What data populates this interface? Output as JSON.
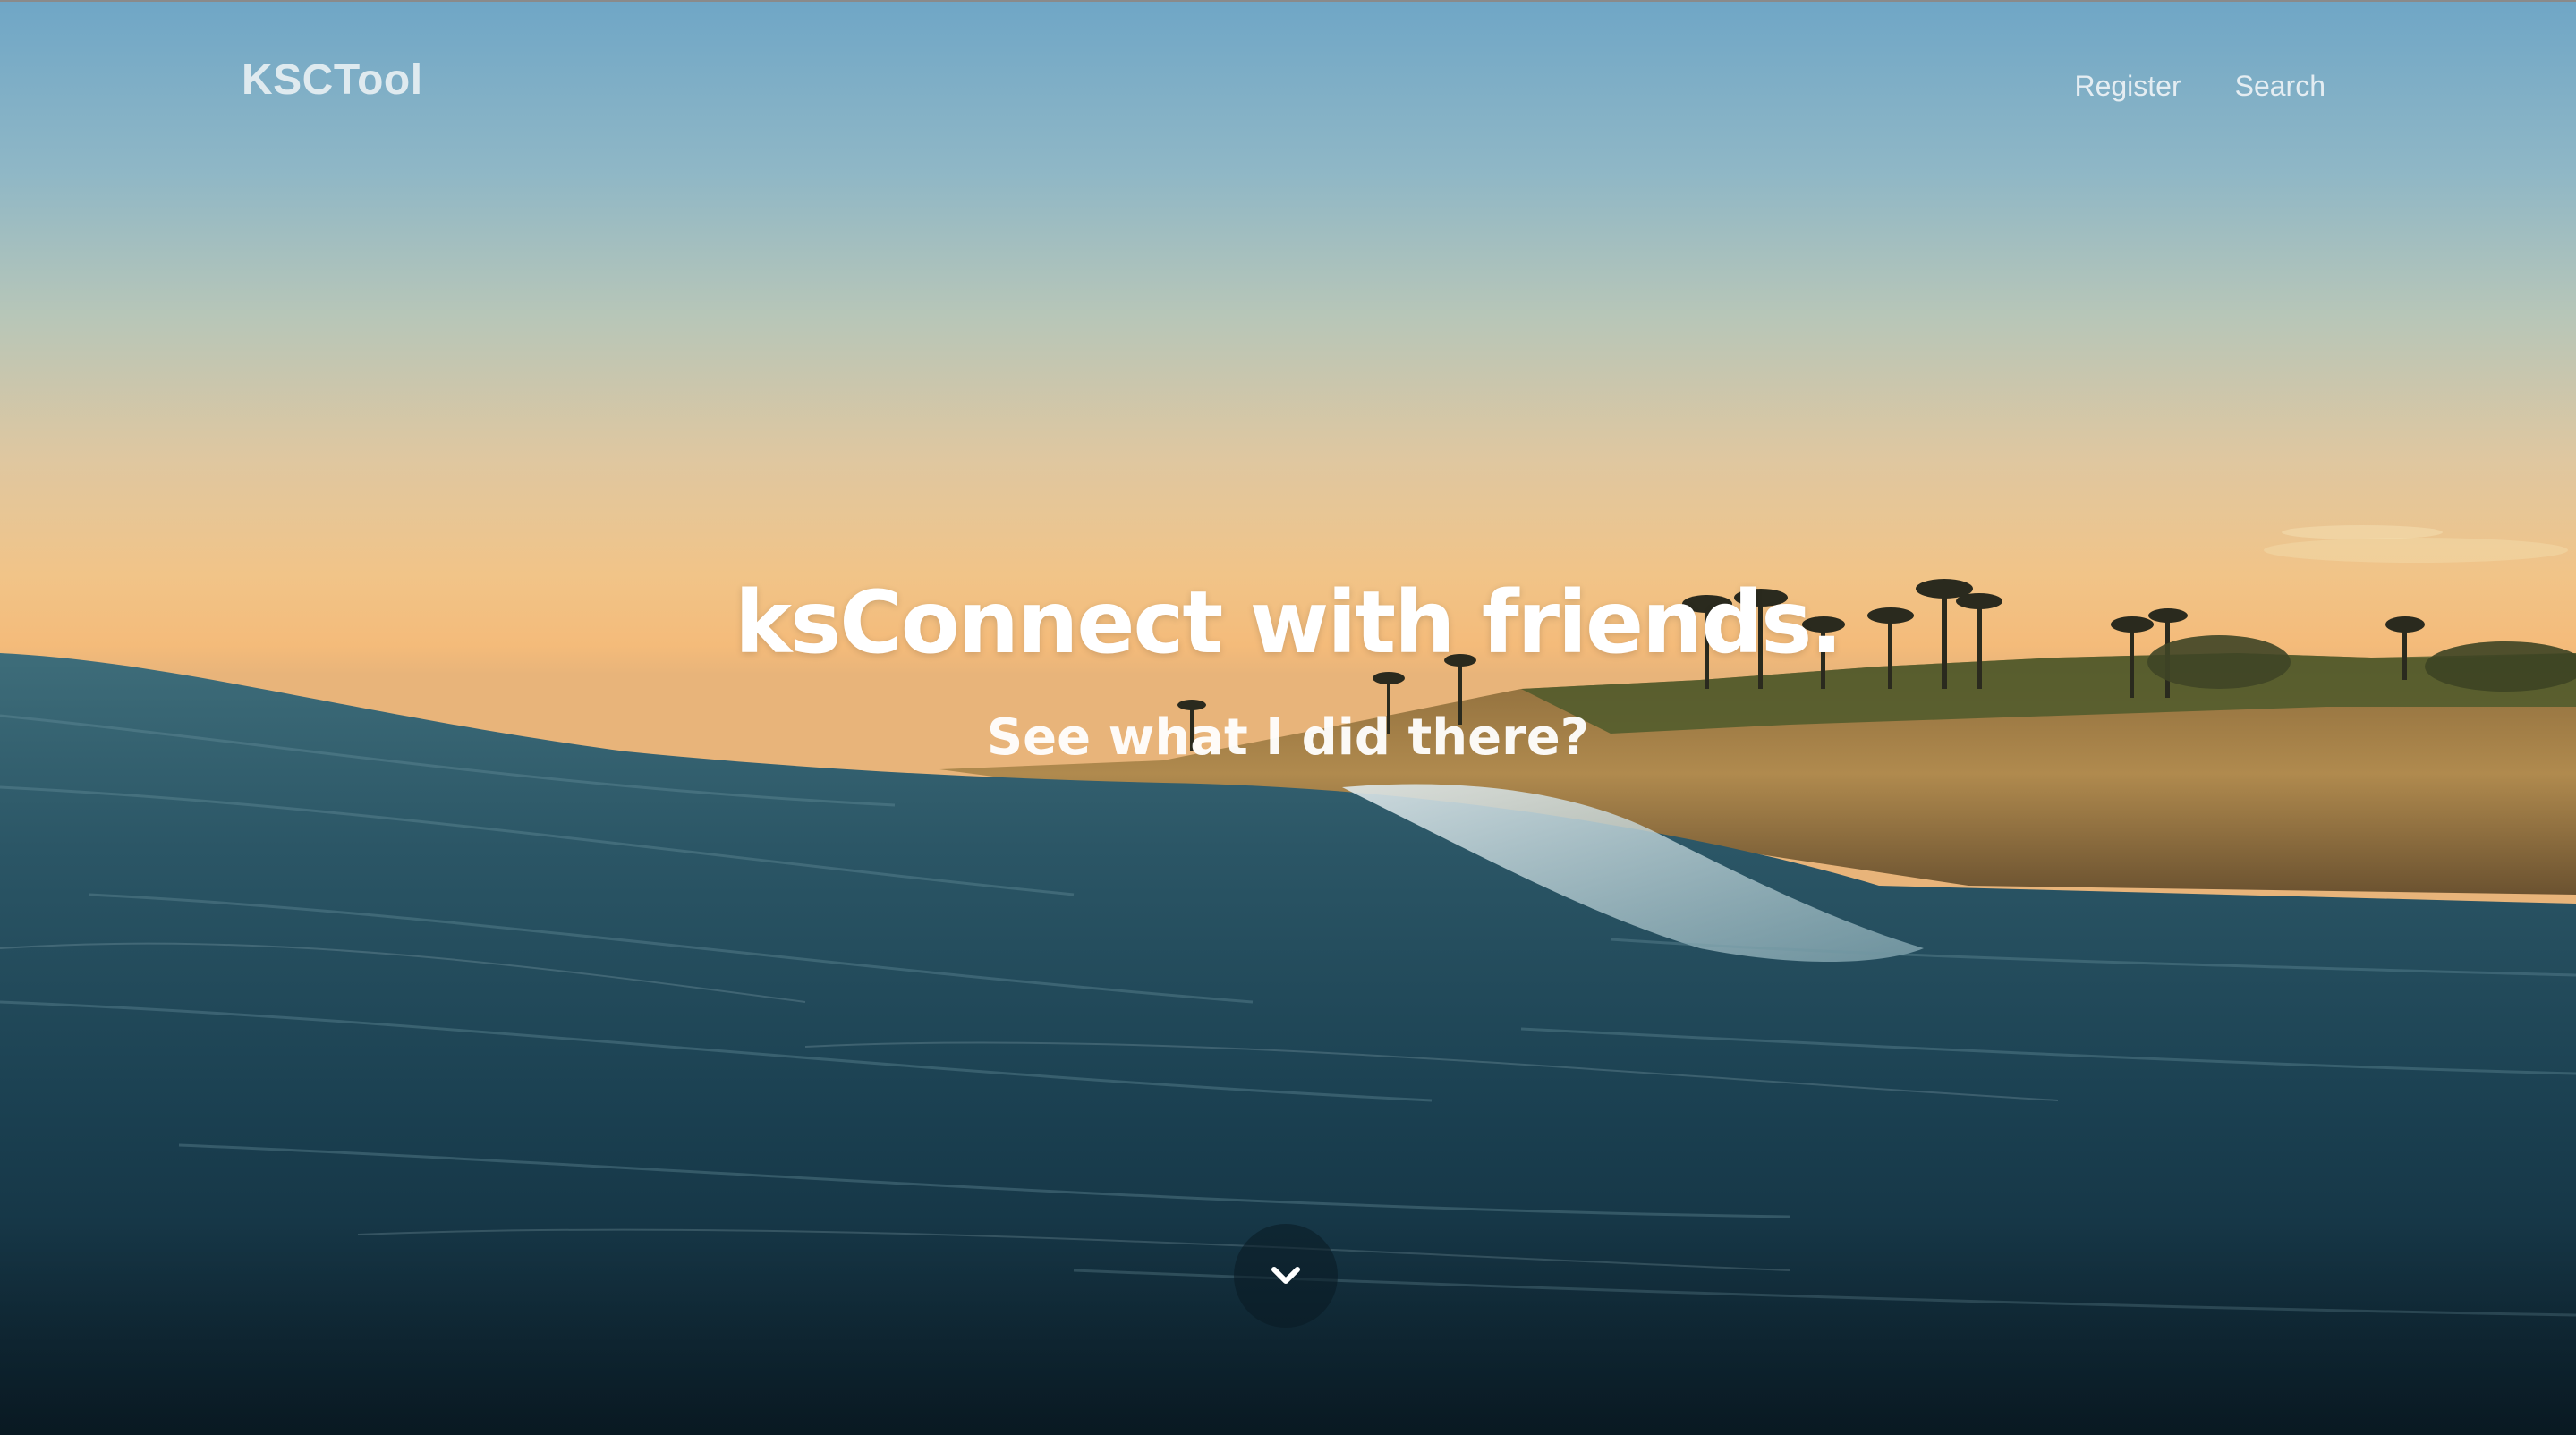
{
  "navbar": {
    "brand": "KSCTool",
    "links": [
      {
        "label": "Register"
      },
      {
        "label": "Search"
      }
    ]
  },
  "hero": {
    "headline": "ksConnect with friends.",
    "subheadline": "See what I did there?",
    "scroll_icon": "chevron-down-icon"
  },
  "colors": {
    "sky_top": "#6fa6c6",
    "sky_horizon": "#f4bb7a",
    "ocean": "#1f4658",
    "text": "#ffffff"
  }
}
